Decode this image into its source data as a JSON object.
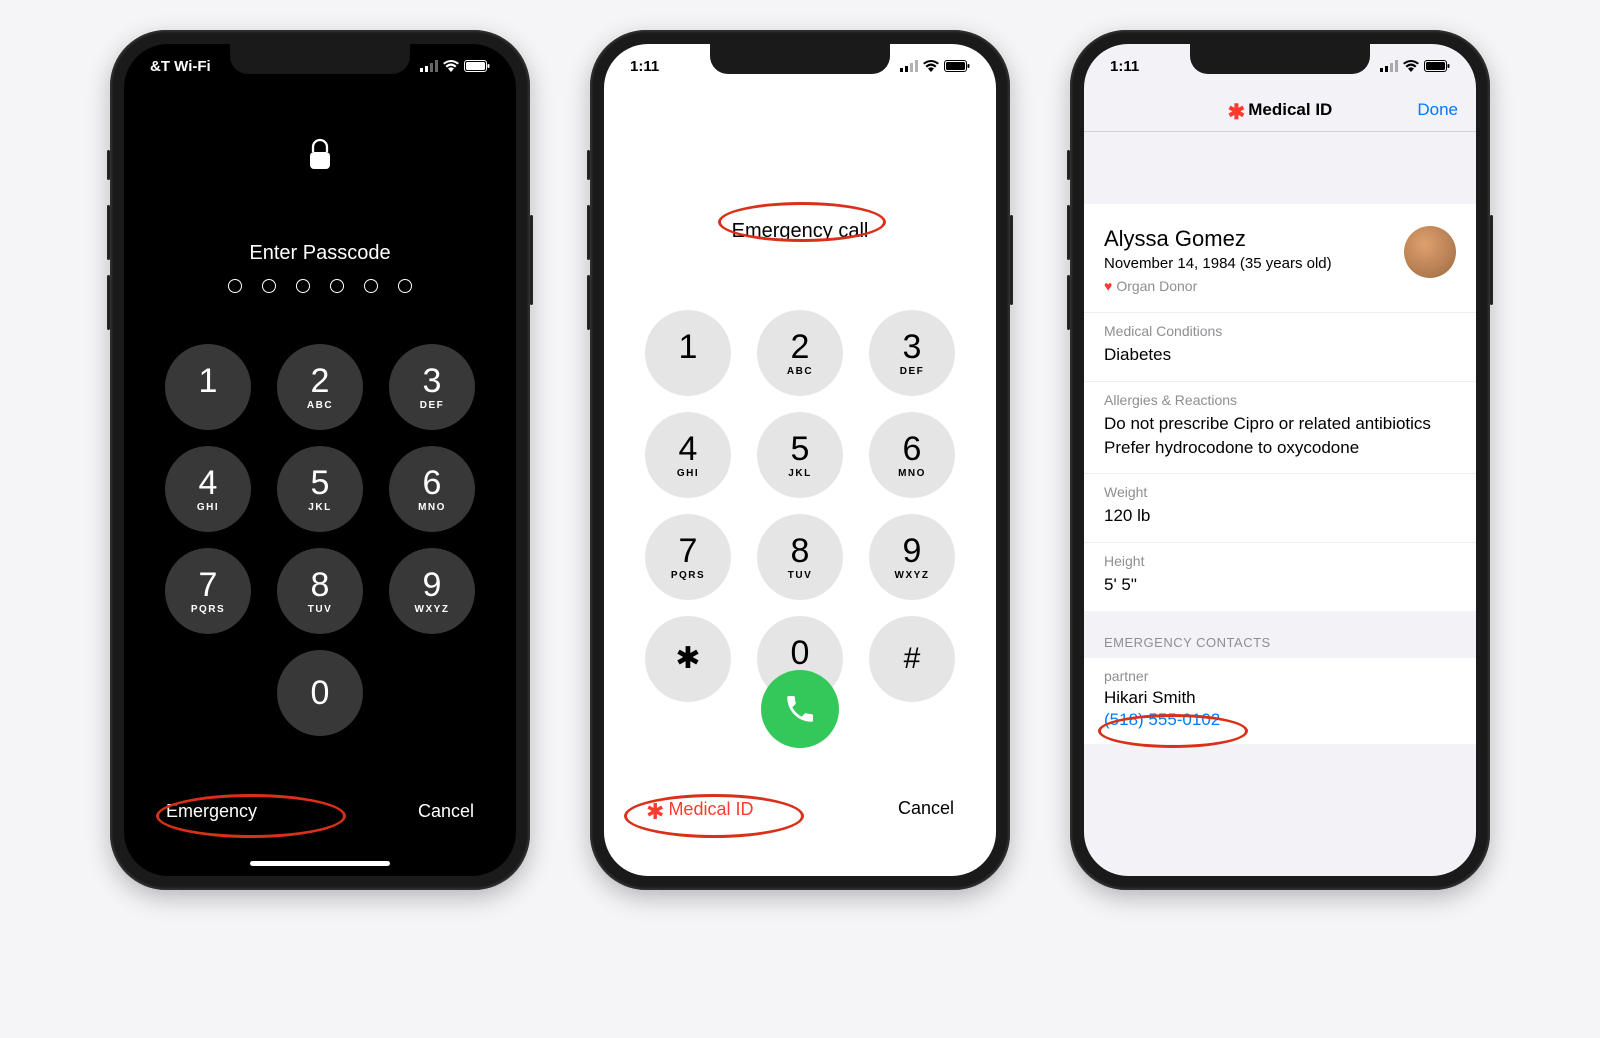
{
  "status": {
    "left_carrier": "&T Wi-Fi",
    "left_time": "1:11"
  },
  "phone1": {
    "passcode_prompt": "Enter Passcode",
    "emergency": "Emergency",
    "cancel": "Cancel",
    "keys": [
      {
        "n": "1",
        "l": ""
      },
      {
        "n": "2",
        "l": "ABC"
      },
      {
        "n": "3",
        "l": "DEF"
      },
      {
        "n": "4",
        "l": "GHI"
      },
      {
        "n": "5",
        "l": "JKL"
      },
      {
        "n": "6",
        "l": "MNO"
      },
      {
        "n": "7",
        "l": "PQRS"
      },
      {
        "n": "8",
        "l": "TUV"
      },
      {
        "n": "9",
        "l": "WXYZ"
      }
    ],
    "zero": "0"
  },
  "phone2": {
    "title": "Emergency call",
    "medical_id": "Medical ID",
    "cancel": "Cancel",
    "keys": [
      {
        "n": "1",
        "l": ""
      },
      {
        "n": "2",
        "l": "ABC"
      },
      {
        "n": "3",
        "l": "DEF"
      },
      {
        "n": "4",
        "l": "GHI"
      },
      {
        "n": "5",
        "l": "JKL"
      },
      {
        "n": "6",
        "l": "MNO"
      },
      {
        "n": "7",
        "l": "PQRS"
      },
      {
        "n": "8",
        "l": "TUV"
      },
      {
        "n": "9",
        "l": "WXYZ"
      }
    ],
    "star": "✱",
    "zero": {
      "n": "0",
      "sub": "+"
    },
    "hash": "#"
  },
  "phone3": {
    "title": "Medical ID",
    "done": "Done",
    "name": "Alyssa Gomez",
    "dob": "November 14, 1984 (35 years old)",
    "organ_donor": "Organ Donor",
    "sections": {
      "conditions": {
        "label": "Medical Conditions",
        "value": "Diabetes"
      },
      "allergies": {
        "label": "Allergies & Reactions",
        "value": "Do not prescribe Cipro or related antibiotics\nPrefer hydrocodone to oxycodone"
      },
      "weight": {
        "label": "Weight",
        "value": "120 lb"
      },
      "height": {
        "label": "Height",
        "value": "5' 5\""
      }
    },
    "contacts_header": "EMERGENCY CONTACTS",
    "contact": {
      "rel": "partner",
      "name": "Hikari Smith",
      "phone": "(518) 555-0102"
    }
  }
}
